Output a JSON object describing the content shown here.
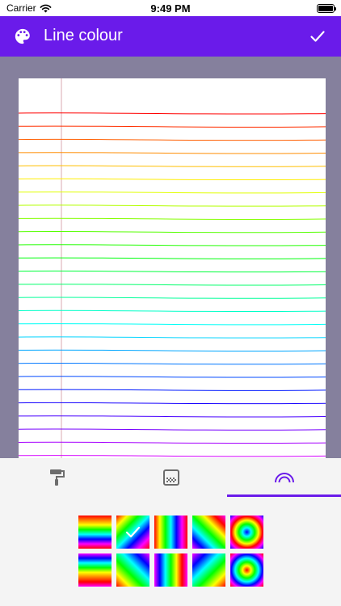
{
  "status_bar": {
    "carrier": "Carrier",
    "time": "9:49 PM",
    "icons": [
      "wifi-icon",
      "battery-icon"
    ]
  },
  "app_bar": {
    "title": "Line colour",
    "left_icon": "palette-icon",
    "right_icon": "checkmark-icon",
    "background_color": "#6a1bea"
  },
  "preview": {
    "background_color": "#85809d",
    "paper_color": "#ffffff",
    "margin_line_color": "#d8a8b0",
    "ruled_line_count": 27,
    "line_colors": "rainbow"
  },
  "tabs": [
    {
      "icon": "paint-roller-icon",
      "selected": false
    },
    {
      "icon": "texture-icon",
      "selected": false
    },
    {
      "icon": "rainbow-icon",
      "selected": true
    }
  ],
  "swatches": [
    {
      "style": "horizontal-rainbow",
      "selected": false
    },
    {
      "style": "diagonal-rainbow",
      "selected": true
    },
    {
      "style": "vertical-rainbow",
      "selected": false
    },
    {
      "style": "diagonal-rainbow-reverse",
      "selected": false
    },
    {
      "style": "radial-rainbow",
      "selected": false
    },
    {
      "style": "horizontal-rainbow-reverse",
      "selected": false
    },
    {
      "style": "diagonal-rainbow-alt",
      "selected": false
    },
    {
      "style": "vertical-rainbow-reverse",
      "selected": false
    },
    {
      "style": "diagonal-rainbow-alt-reverse",
      "selected": false
    },
    {
      "style": "radial-rainbow-reverse",
      "selected": false
    }
  ]
}
